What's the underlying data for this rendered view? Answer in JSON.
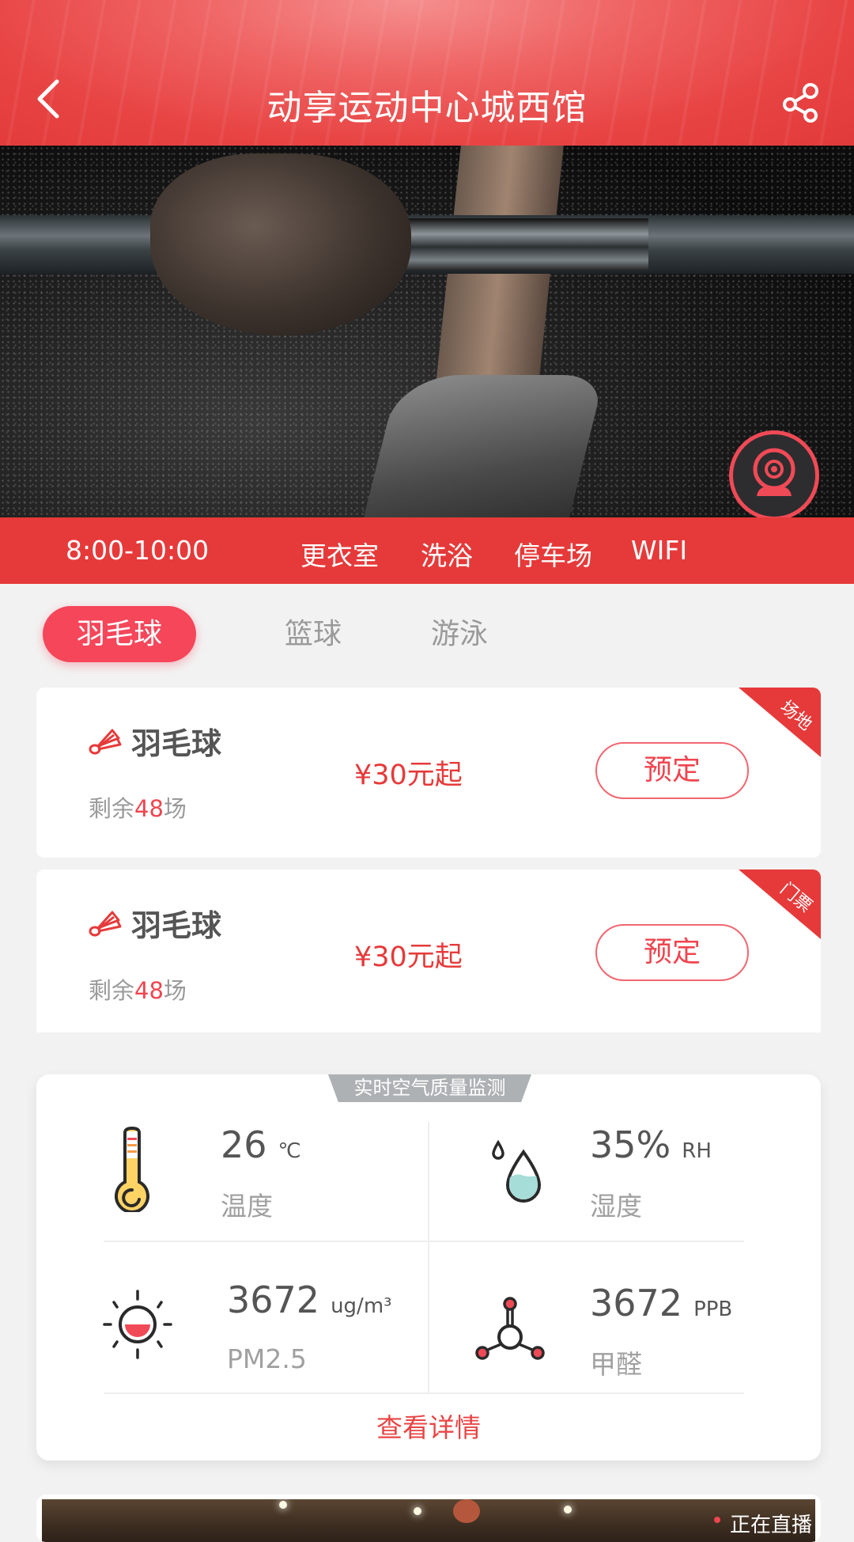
{
  "header": {
    "title": "动享运动中心城西馆",
    "back_icon": "chevron-left-icon",
    "share_icon": "share-icon"
  },
  "hero": {
    "camera_icon": "webcam-icon"
  },
  "info_bar": {
    "hours": "8:00-10:00",
    "facilities": [
      "更衣室",
      "洗浴",
      "停车场",
      "WIFI"
    ]
  },
  "tabs": [
    {
      "label": "羽毛球",
      "active": true
    },
    {
      "label": "篮球",
      "active": false
    },
    {
      "label": "游泳",
      "active": false
    }
  ],
  "venue_cards": [
    {
      "sport": "羽毛球",
      "remaining_prefix": "剩余",
      "remaining_count": "48",
      "remaining_suffix": "场",
      "price": "¥30元起",
      "button": "预定",
      "ribbon": "场地",
      "icon": "shuttlecock-icon"
    },
    {
      "sport": "羽毛球",
      "remaining_prefix": "剩余",
      "remaining_count": "48",
      "remaining_suffix": "场",
      "price": "¥30元起",
      "button": "预定",
      "ribbon": "门票",
      "icon": "shuttlecock-icon"
    }
  ],
  "air_quality": {
    "title": "实时空气质量监测",
    "metrics": [
      {
        "value": "26",
        "unit": "℃",
        "label": "温度",
        "icon": "thermometer-icon"
      },
      {
        "value": "35%",
        "unit": "RH",
        "label": "湿度",
        "icon": "water-drop-icon"
      },
      {
        "value": "3672",
        "unit": "ug/m³",
        "label": "PM2.5",
        "icon": "pm25-sun-icon"
      },
      {
        "value": "3672",
        "unit": "PPB",
        "label": "甲醛",
        "icon": "molecule-icon"
      }
    ],
    "detail_link": "查看详情"
  },
  "live_card": {
    "label": "正在直播"
  },
  "colors": {
    "brand_red": "#e63a3a",
    "active_tab": "#f5465a",
    "price_red": "#f0454f",
    "badge_gray": "#aeb1b3"
  }
}
